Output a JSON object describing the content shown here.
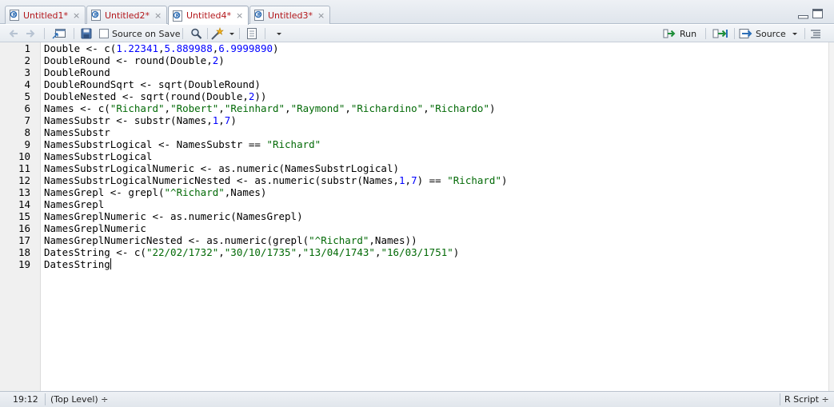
{
  "tabs": [
    {
      "label": "Untitled1*",
      "close": "×",
      "active": false
    },
    {
      "label": "Untitled2*",
      "close": "×",
      "active": false
    },
    {
      "label": "Untitled4*",
      "close": "×",
      "active": true
    },
    {
      "label": "Untitled3*",
      "close": "×",
      "active": false
    }
  ],
  "toolbar": {
    "source_on_save_label": "Source on Save",
    "source_on_save_checked": false,
    "run_label": "Run",
    "source_label": "Source",
    "icons": [
      "back-arrow-icon",
      "forward-arrow-icon",
      "show-in-window-icon",
      "save-icon",
      "search-icon",
      "magic-wand-icon",
      "compile-report-icon",
      "more-dropdown-icon",
      "rerun-icon",
      "outline-icon"
    ]
  },
  "editor": {
    "line_numbers": [
      "1",
      "2",
      "3",
      "4",
      "5",
      "6",
      "7",
      "8",
      "9",
      "10",
      "11",
      "12",
      "13",
      "14",
      "15",
      "16",
      "17",
      "18",
      "19"
    ],
    "lines": [
      [
        {
          "t": "Double <- c(",
          "c": "p"
        },
        {
          "t": "1.22341",
          "c": "n"
        },
        {
          "t": ",",
          "c": "p"
        },
        {
          "t": "5.889988",
          "c": "n"
        },
        {
          "t": ",",
          "c": "p"
        },
        {
          "t": "6.9999890",
          "c": "n"
        },
        {
          "t": ")",
          "c": "p"
        }
      ],
      [
        {
          "t": "DoubleRound <- round(Double,",
          "c": "p"
        },
        {
          "t": "2",
          "c": "n"
        },
        {
          "t": ")",
          "c": "p"
        }
      ],
      [
        {
          "t": "DoubleRound",
          "c": "p"
        }
      ],
      [
        {
          "t": "DoubleRoundSqrt <- sqrt(DoubleRound)",
          "c": "p"
        }
      ],
      [
        {
          "t": "DoubleNested <- sqrt(round(Double,",
          "c": "p"
        },
        {
          "t": "2",
          "c": "n"
        },
        {
          "t": "))",
          "c": "p"
        }
      ],
      [
        {
          "t": "Names <- c(",
          "c": "p"
        },
        {
          "t": "\"Richard\"",
          "c": "s"
        },
        {
          "t": ",",
          "c": "p"
        },
        {
          "t": "\"Robert\"",
          "c": "s"
        },
        {
          "t": ",",
          "c": "p"
        },
        {
          "t": "\"Reinhard\"",
          "c": "s"
        },
        {
          "t": ",",
          "c": "p"
        },
        {
          "t": "\"Raymond\"",
          "c": "s"
        },
        {
          "t": ",",
          "c": "p"
        },
        {
          "t": "\"Richardino\"",
          "c": "s"
        },
        {
          "t": ",",
          "c": "p"
        },
        {
          "t": "\"Richardo\"",
          "c": "s"
        },
        {
          "t": ")",
          "c": "p"
        }
      ],
      [
        {
          "t": "NamesSubstr <- substr(Names,",
          "c": "p"
        },
        {
          "t": "1",
          "c": "n"
        },
        {
          "t": ",",
          "c": "p"
        },
        {
          "t": "7",
          "c": "n"
        },
        {
          "t": ")",
          "c": "p"
        }
      ],
      [
        {
          "t": "NamesSubstr",
          "c": "p"
        }
      ],
      [
        {
          "t": "NamesSubstrLogical <- NamesSubstr == ",
          "c": "p"
        },
        {
          "t": "\"Richard\"",
          "c": "s"
        }
      ],
      [
        {
          "t": "NamesSubstrLogical",
          "c": "p"
        }
      ],
      [
        {
          "t": "NamesSubstrLogicalNumeric <- as.numeric(NamesSubstrLogical)",
          "c": "p"
        }
      ],
      [
        {
          "t": "NamesSubstrLogicalNumericNested <- as.numeric(substr(Names,",
          "c": "p"
        },
        {
          "t": "1",
          "c": "n"
        },
        {
          "t": ",",
          "c": "p"
        },
        {
          "t": "7",
          "c": "n"
        },
        {
          "t": ") == ",
          "c": "p"
        },
        {
          "t": "\"Richard\"",
          "c": "s"
        },
        {
          "t": ")",
          "c": "p"
        }
      ],
      [
        {
          "t": "NamesGrepl <- grepl(",
          "c": "p"
        },
        {
          "t": "\"^Richard\"",
          "c": "s"
        },
        {
          "t": ",Names)",
          "c": "p"
        }
      ],
      [
        {
          "t": "NamesGrepl",
          "c": "p"
        }
      ],
      [
        {
          "t": "NamesGreplNumeric <- as.numeric(NamesGrepl)",
          "c": "p"
        }
      ],
      [
        {
          "t": "NamesGreplNumeric",
          "c": "p"
        }
      ],
      [
        {
          "t": "NamesGreplNumericNested <- as.numeric(grepl(",
          "c": "p"
        },
        {
          "t": "\"^Richard\"",
          "c": "s"
        },
        {
          "t": ",Names))",
          "c": "p"
        }
      ],
      [
        {
          "t": "DatesString <- c(",
          "c": "p"
        },
        {
          "t": "\"22/02/1732\"",
          "c": "s"
        },
        {
          "t": ",",
          "c": "p"
        },
        {
          "t": "\"30/10/1735\"",
          "c": "s"
        },
        {
          "t": ",",
          "c": "p"
        },
        {
          "t": "\"13/04/1743\"",
          "c": "s"
        },
        {
          "t": ",",
          "c": "p"
        },
        {
          "t": "\"16/03/1751\"",
          "c": "s"
        },
        {
          "t": ")",
          "c": "p"
        }
      ],
      [
        {
          "t": "DatesString",
          "c": "p"
        }
      ]
    ]
  },
  "status": {
    "position": "19:12",
    "scope": "(Top Level) ÷",
    "filetype": "R Script ÷"
  }
}
